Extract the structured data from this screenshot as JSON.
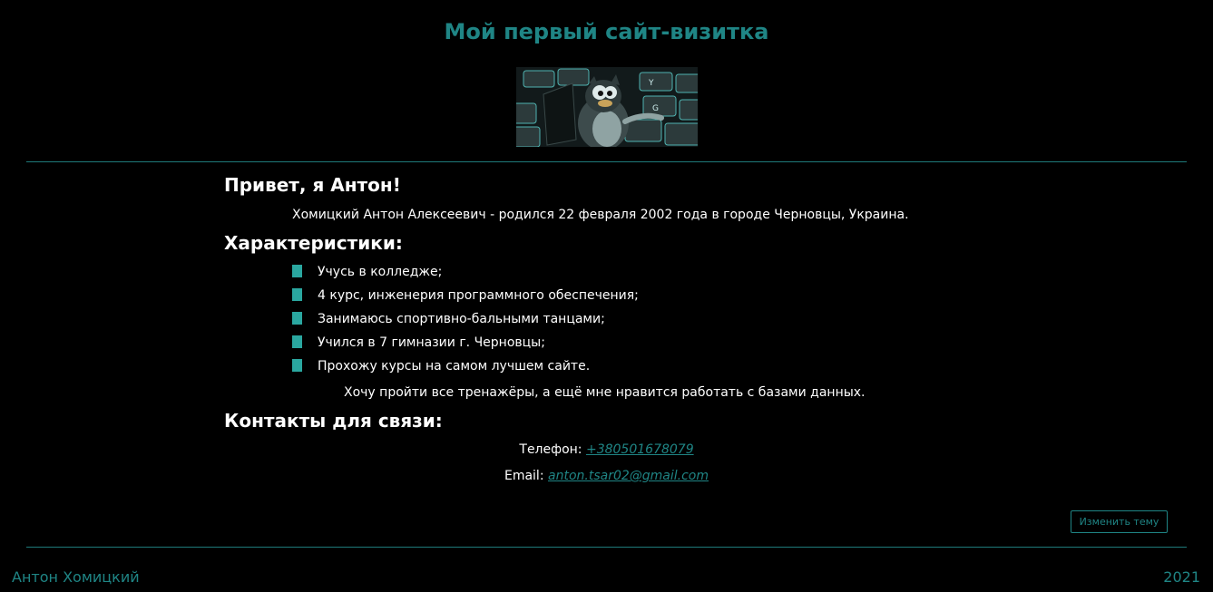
{
  "header": {
    "title": "Мой первый сайт-визитка",
    "image_icon": "penguin-keyboard-image"
  },
  "intro": {
    "heading": "Привет, я Антон!",
    "bio": "Хомицкий Антон Алексеевич - родился 22 февраля 2002 года в городе Черновцы, Украина."
  },
  "features": {
    "heading": "Характеристики:",
    "items": [
      "Учусь в колледже;",
      "4 курс, инженерия программного обеспечения;",
      "Занимаюсь спортивно-бальными танцами;",
      "Учился в 7 гимназии г. Черновцы;",
      "Прохожу курсы на самом лучшем сайте."
    ],
    "extra": "Хочу пройти все тренажёры, а ещё мне нравится работать с базами данных."
  },
  "contacts": {
    "heading": "Контакты для связи:",
    "phone_label": "Телефон:",
    "phone_value": "+380501678079",
    "email_label": "Email:",
    "email_value": "anton.tsar02@gmail.com"
  },
  "theme_button": {
    "label": "Изменить тему"
  },
  "footer": {
    "author": "Антон Хомицкий",
    "year": "2021"
  },
  "colors": {
    "background": "#000000",
    "accent": "#1f8585",
    "bullet": "#2aa7a0",
    "text": "#ffffff"
  }
}
